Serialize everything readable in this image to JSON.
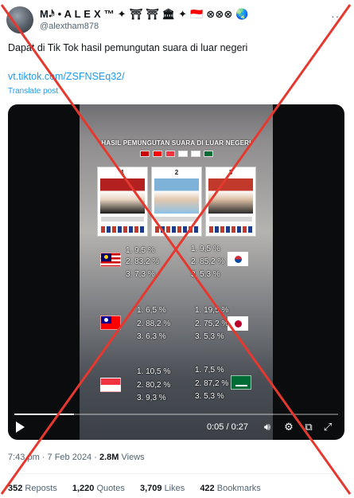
{
  "tweet": {
    "display_name": "M𝆺𝅥𝅯 • A L E X ™ ✦ ⛩ ⛩ 🏛 ✦ 🇮🇩 ⊗⊗⊗ 🌏",
    "handle": "@alextham878",
    "text": "Dapat di Tik Tok hasil pemungutan suara di luar negeri",
    "link": "vt.tiktok.com/ZSFNSEq32/",
    "translate": "Translate post",
    "timestamp": "7:43 pm · 7 Feb 2024 ·",
    "views_count": "2.8M",
    "views_label": "Views",
    "reposts_count": "352",
    "reposts_label": "Reposts",
    "quotes_count": "1,220",
    "quotes_label": "Quotes",
    "likes_count": "3,709",
    "likes_label": "Likes",
    "bookmarks_count": "422",
    "bookmarks_label": "Bookmarks"
  },
  "video": {
    "banner": "HASIL PEMUNGUTAN SUARA DI LUAR NEGERI",
    "candidate_numbers": [
      "1",
      "2",
      "3"
    ],
    "results": [
      {
        "country": "Malaysia",
        "flag_colors": [
          "#cc0001",
          "#010066",
          "#ffcc00"
        ],
        "lines": [
          "1. 9,5 %",
          "2. 83,2 %",
          "3. 7,3 %"
        ]
      },
      {
        "country": "South Korea",
        "flag_colors": [
          "#ffffff",
          "#cd2e3a",
          "#0047a0"
        ],
        "lines": [
          "1. 9,5 %",
          "2. 85,2 %",
          "3. 5,3 %"
        ]
      },
      {
        "country": "Taiwan",
        "flag_colors": [
          "#fe0000",
          "#000095",
          "#ffffff"
        ],
        "lines": [
          "1. 6,5 %",
          "2. 88,2 %",
          "3. 6,3 %"
        ]
      },
      {
        "country": "Japan",
        "flag_colors": [
          "#ffffff",
          "#bc002d",
          "#ffffff"
        ],
        "lines": [
          "1. 19,5 %",
          "2. 75,2 %",
          "3. 5,3 %"
        ]
      },
      {
        "country": "Singapore",
        "flag_colors": [
          "#ef3340",
          "#ffffff",
          "#ffffff"
        ],
        "lines": [
          "1. 10,5 %",
          "2. 80,2 %",
          "3. 9,3 %"
        ]
      },
      {
        "country": "Saudi Arabia",
        "flag_colors": [
          "#006c35",
          "#ffffff",
          "#006c35"
        ],
        "lines": [
          "1. 7,5 %",
          "2. 87,2 %",
          "3. 5,3 %"
        ]
      }
    ],
    "time_readout": "0:05 / 0:27",
    "progress_fraction": 0.185
  },
  "icons": {
    "more": "more-icon",
    "play": "play-icon",
    "volume": "volume-icon",
    "settings": "settings-icon",
    "pip": "picture-in-picture-icon",
    "fullscreen": "fullscreen-icon"
  },
  "colors": {
    "link": "#1d9bf0",
    "muted": "#536471",
    "cross": "#e5382f"
  }
}
